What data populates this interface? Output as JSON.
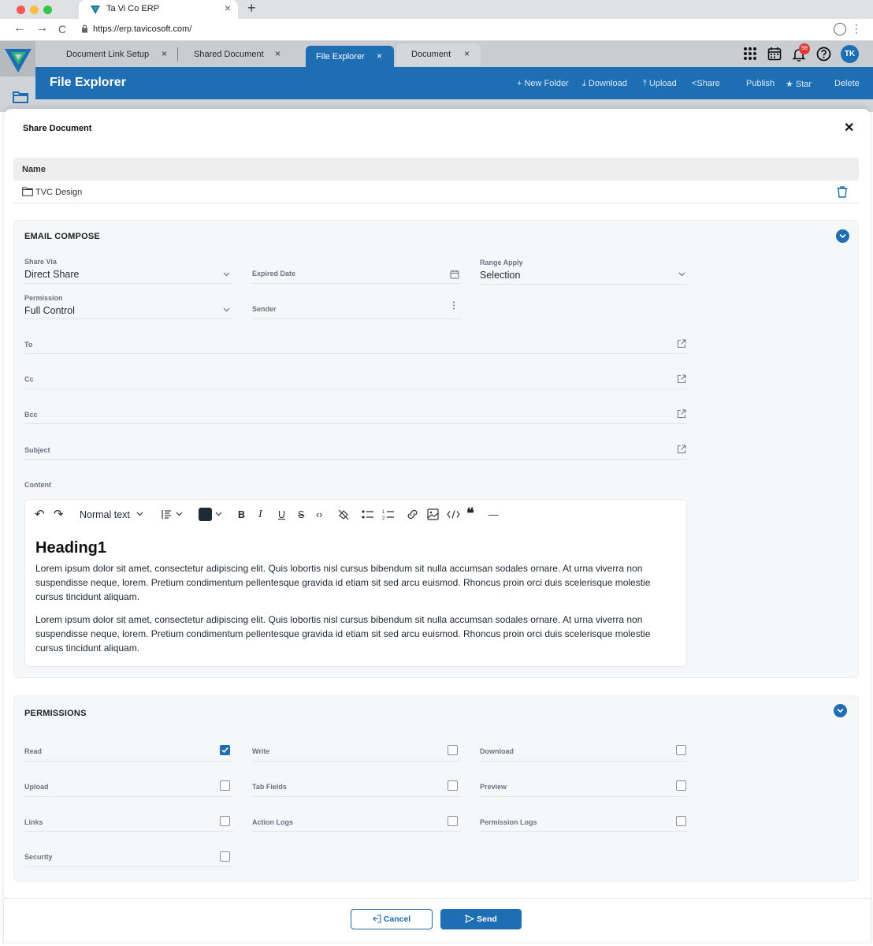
{
  "browser": {
    "tab_title": "Ta Vi Co ERP",
    "tab_close": "×",
    "new_tab": "+",
    "url": "https://erp.tavicosoft.com/",
    "back": "←",
    "forward": "→",
    "reload": "C",
    "menu": "⋮"
  },
  "app_tabs": [
    {
      "label": "Document Link Setup",
      "close": "×"
    },
    {
      "label": "Shared Document",
      "close": "×"
    },
    {
      "label": "File Explorer",
      "close": "×"
    },
    {
      "label": "Document",
      "close": "×"
    }
  ],
  "top_icons": {
    "apps": "apps-grid-icon",
    "calendar": "calendar-icon",
    "notifications": "bell-icon",
    "help": "help-icon",
    "notification_count": "98",
    "avatar": "TK"
  },
  "header": {
    "title": "File Explorer",
    "actions": {
      "new_folder": "+ New Folder",
      "download": "⤓ Download",
      "upload": "⤒ Upload",
      "share": "<Share",
      "publish": "Publish",
      "star": "★ Star",
      "delete": "Delete"
    }
  },
  "modal": {
    "title": "Share Document",
    "close": "✕",
    "table": {
      "header": "Name",
      "row": "TVC Design"
    }
  },
  "email": {
    "title": "EMAIL COMPOSE",
    "share_via": {
      "label": "Share Via",
      "value": "Direct Share"
    },
    "expired_date": {
      "label": "Expired Date"
    },
    "range_apply": {
      "label": "Range Apply",
      "value": "Selection"
    },
    "permission": {
      "label": "Permission",
      "value": "Full Control"
    },
    "sender": {
      "label": "Sender"
    },
    "to": {
      "label": "To"
    },
    "cc": {
      "label": "Cc"
    },
    "bcc": {
      "label": "Bcc"
    },
    "subject": {
      "label": "Subject"
    },
    "content": {
      "label": "Content"
    },
    "editor": {
      "undo": "↶",
      "redo": "↷",
      "format": "Normal text",
      "bold": "B",
      "italic": "I",
      "underline": "U",
      "strike": "S",
      "code": "‹›",
      "quote": "❝",
      "hr": "—",
      "heading": "Heading1",
      "paragraphs": [
        "Lorem ipsum dolor sit amet, consectetur adipiscing elit. Quis lobortis nisl cursus bibendum sit nulla accumsan sodales ornare. At urna viverra non suspendisse neque, lorem. Pretium condimentum pellentesque gravida id etiam sit sed arcu euismod. Rhoncus proin orci duis scelerisque molestie cursus tincidunt aliquam.",
        "Lorem ipsum dolor sit amet, consectetur adipiscing elit. Quis lobortis nisl cursus bibendum sit nulla accumsan sodales ornare. At urna viverra non suspendisse neque, lorem. Pretium condimentum pellentesque gravida id etiam sit sed arcu euismod. Rhoncus proin orci duis scelerisque molestie cursus tincidunt aliquam."
      ]
    }
  },
  "permissions": {
    "title": "PERMISSIONS",
    "items": [
      {
        "label": "Read",
        "checked": true
      },
      {
        "label": "Write",
        "checked": false
      },
      {
        "label": "Download",
        "checked": false
      },
      {
        "label": "Upload",
        "checked": false
      },
      {
        "label": "Tab Fields",
        "checked": false
      },
      {
        "label": "Preview",
        "checked": false
      },
      {
        "label": "Links",
        "checked": false
      },
      {
        "label": "Action Logs",
        "checked": false
      },
      {
        "label": "Permission Logs",
        "checked": false
      },
      {
        "label": "Security",
        "checked": false
      }
    ]
  },
  "footer": {
    "cancel": "Cancel",
    "send": "Send"
  },
  "colors": {
    "primary": "#1e6eb4",
    "header_bg": "#1e6eb4",
    "badge": "#e53935"
  }
}
